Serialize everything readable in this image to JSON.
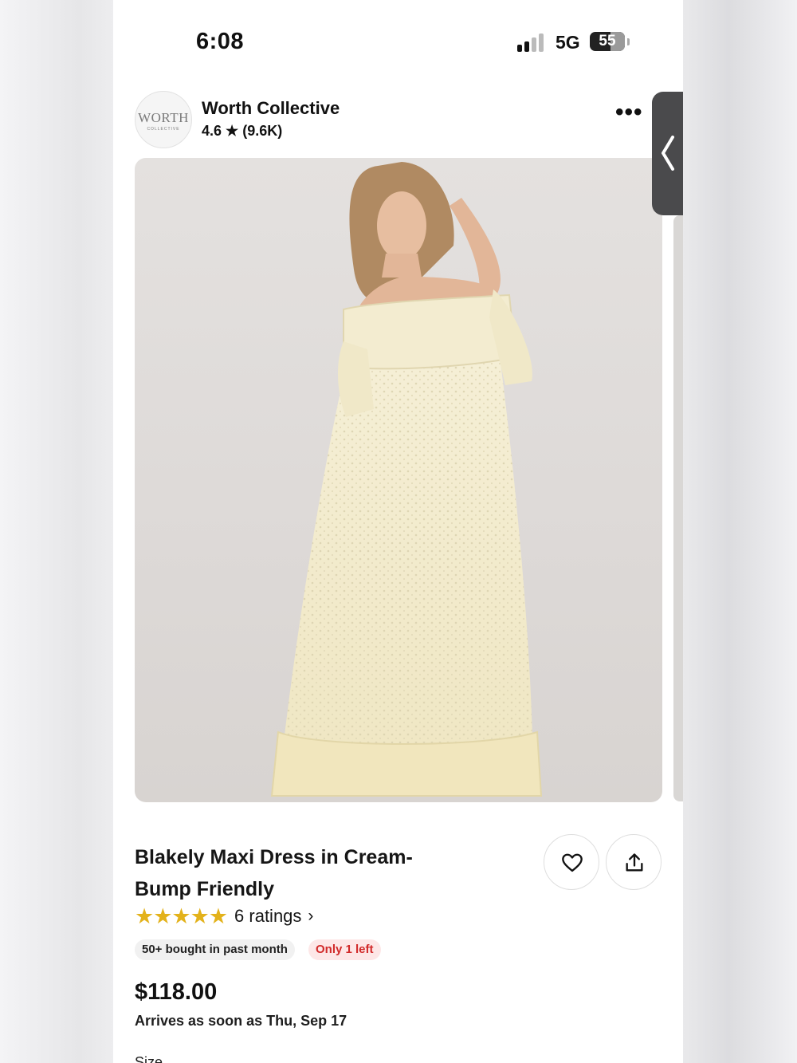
{
  "status_bar": {
    "time": "6:08",
    "network": "5G",
    "battery": "55"
  },
  "seller": {
    "logo_text": "WORTH",
    "logo_subtext": "COLLECTIVE",
    "name": "Worth Collective",
    "rating": "4.6",
    "review_count": "(9.6K)"
  },
  "product": {
    "title": "Blakely Maxi Dress in Cream- Bump Friendly",
    "rating_stars": 5,
    "ratings_text": "6 ratings",
    "bought_badge": "50+ bought in past month",
    "stock_badge": "Only 1 left",
    "price": "$118.00",
    "delivery": "Arrives as soon as Thu, Sep 17",
    "next_section_label": "Size"
  },
  "colors": {
    "star": "#e3b21b",
    "stock_text": "#d12a2a",
    "stock_bg": "#fde7e7",
    "badge_bg": "#f1f1f1"
  }
}
